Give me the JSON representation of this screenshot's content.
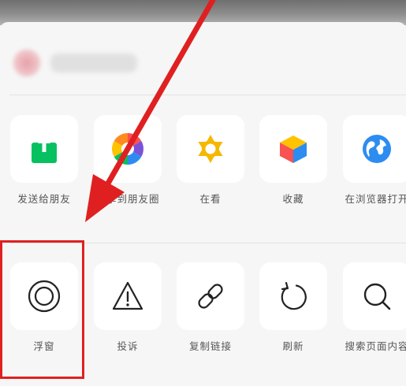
{
  "header": {
    "account_name": "",
    "accent_red": "#e02020"
  },
  "share_row": [
    {
      "label": "发送给朋友",
      "icon": "share-icon"
    },
    {
      "label": "分享到朋友圈",
      "icon": "moments-icon"
    },
    {
      "label": "在看",
      "icon": "wow-icon"
    },
    {
      "label": "收藏",
      "icon": "favorite-cube-icon"
    },
    {
      "label": "在浏览器打开",
      "icon": "browser-globe-icon"
    }
  ],
  "action_row": [
    {
      "label": "浮窗",
      "icon": "floating-window-icon"
    },
    {
      "label": "投诉",
      "icon": "warning-icon"
    },
    {
      "label": "复制链接",
      "icon": "link-icon"
    },
    {
      "label": "刷新",
      "icon": "refresh-icon"
    },
    {
      "label": "搜索页面内容",
      "icon": "search-icon"
    }
  ]
}
